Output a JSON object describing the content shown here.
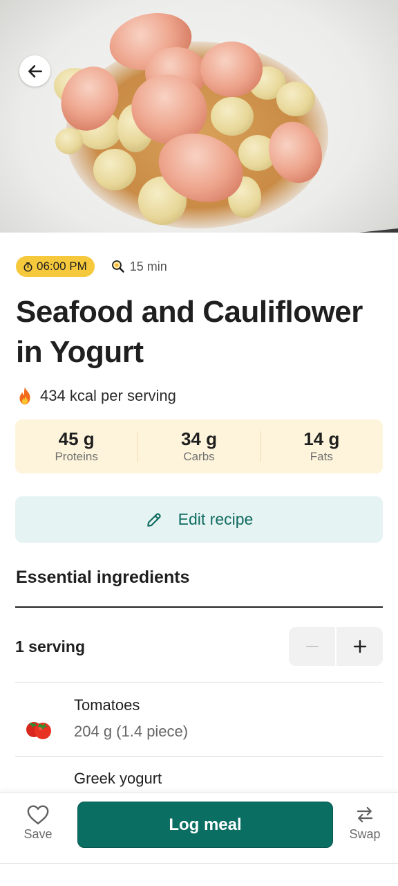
{
  "hero": {
    "image_alt": "Seafood and Cauliflower in Yogurt photo"
  },
  "meta": {
    "time": "06:00 PM",
    "duration": "15 min"
  },
  "title": "Seafood and Cauliflower in Yogurt",
  "calories": "434 kcal per serving",
  "macros": [
    {
      "value": "45 g",
      "label": "Proteins"
    },
    {
      "value": "34 g",
      "label": "Carbs"
    },
    {
      "value": "14 g",
      "label": "Fats"
    }
  ],
  "edit_button": {
    "label": "Edit recipe"
  },
  "ingredients_section": {
    "title": "Essential ingredients",
    "serving_label": "1 serving",
    "items": [
      {
        "name": "Tomatoes",
        "amount": "204 g (1.4 piece)",
        "icon": "tomato-icon"
      },
      {
        "name": "Greek yogurt",
        "amount": "",
        "icon": "yogurt-icon"
      }
    ]
  },
  "bottom_bar": {
    "save_label": "Save",
    "log_label": "Log meal",
    "swap_label": "Swap"
  },
  "colors": {
    "accent": "#0a6e63",
    "time_chip": "#f6c83c",
    "macro_bg": "#fdf4db",
    "edit_bg": "#e6f3f3"
  }
}
